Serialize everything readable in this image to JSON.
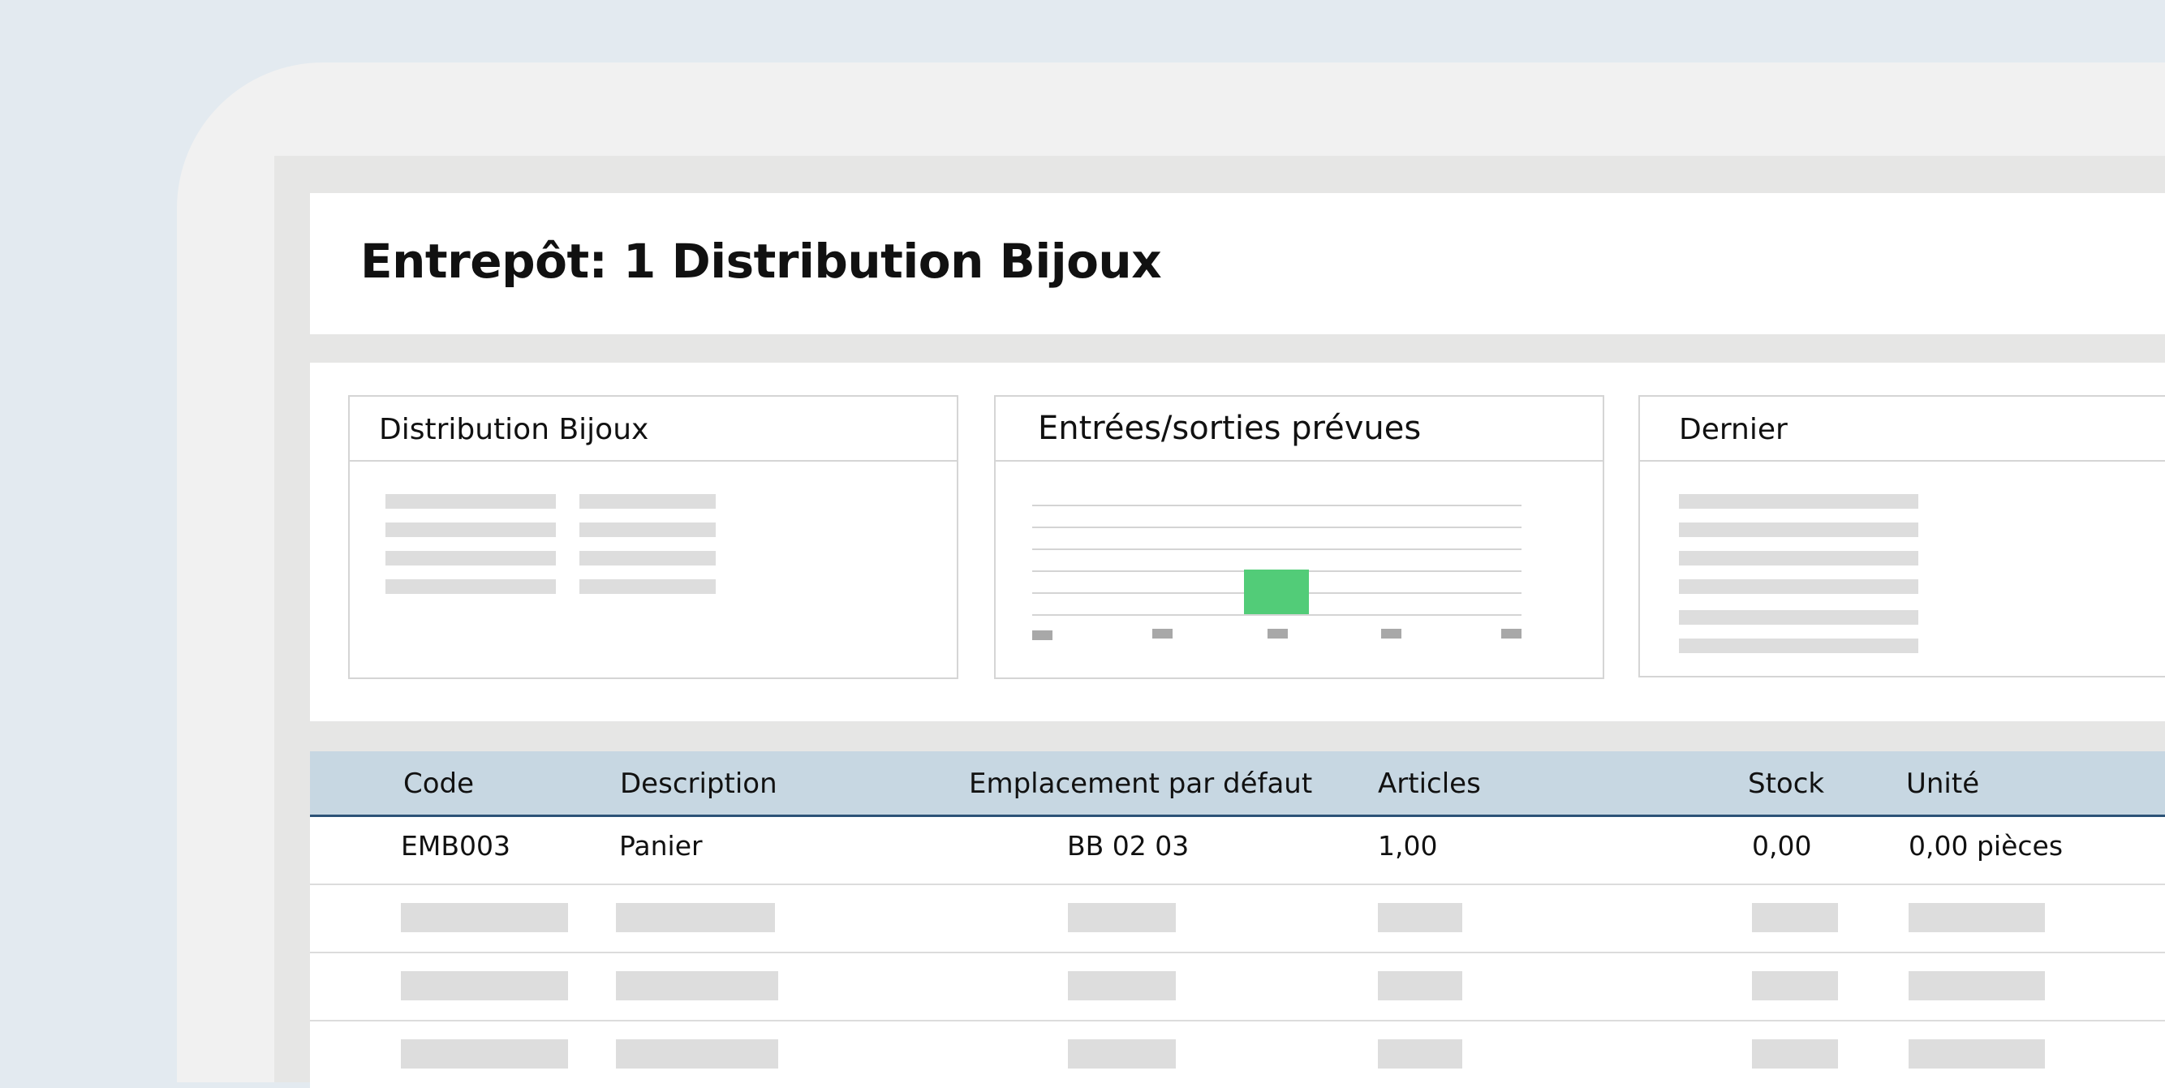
{
  "page": {
    "title": "Entrepôt: 1 Distribution Bijoux"
  },
  "cards": {
    "distribution": {
      "title": "Distribution Bijoux"
    },
    "movements": {
      "title": "Entrées/sorties prévues",
      "bar_color": "#52cc78"
    },
    "last": {
      "title": "Dernier"
    }
  },
  "table": {
    "columns": [
      "Code",
      "Description",
      "Emplacement par défaut",
      "Articles",
      "Stock",
      "Unité"
    ],
    "rows": [
      {
        "code": "EMB003",
        "description": "Panier",
        "location": "BB 02 03",
        "articles": "1,00",
        "stock": "0,00",
        "unit": "0,00 pièces"
      }
    ]
  },
  "colors": {
    "background": "#e3eaf0",
    "header_bg": "#c7d7e2",
    "header_border": "#2c5277",
    "accent_green": "#52cc78"
  }
}
